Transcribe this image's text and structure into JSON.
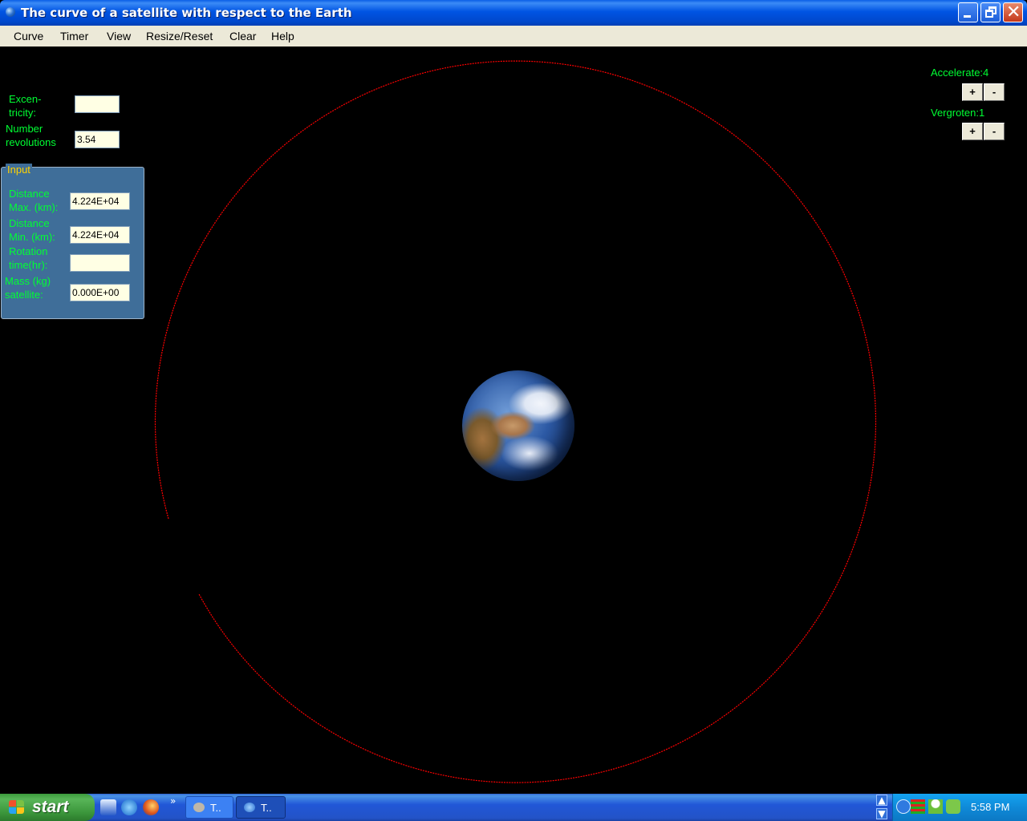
{
  "window": {
    "title": "The curve of a satellite with respect to the Earth",
    "min_icon": "minimize-icon",
    "max_icon": "restore-icon",
    "close_glyph": "✕"
  },
  "menu": [
    "Curve",
    "Timer",
    "View",
    "Resize/Reset",
    "Clear",
    "Help"
  ],
  "left_panel": {
    "eccentricity_label_1": "Excen-",
    "eccentricity_label_2": "tricity:",
    "eccentricity_value": "",
    "revolutions_label_1": "Number",
    "revolutions_label_2": "revolutions",
    "revolutions_value": "3.54"
  },
  "input_group": {
    "legend": "Input",
    "dist_max_label_1": "Distance",
    "dist_max_label_2": "Max. (km):",
    "dist_max_value": "4.224E+04",
    "dist_min_label_1": "Distance",
    "dist_min_label_2": "Min. (km):",
    "dist_min_value": "4.224E+04",
    "rotation_label_1": "Rotation",
    "rotation_label_2": "time(hr):",
    "rotation_value": "",
    "mass_label_1": "Mass (kg)",
    "mass_label_2": "satellite:",
    "mass_value": "0.000E+00"
  },
  "right_panel": {
    "accelerate_label": "Accelerate:4",
    "vergroten_label": "Vergroten:1",
    "plus": "+",
    "minus": "-"
  },
  "colors": {
    "label_green": "#00ff33",
    "orbit_red": "#ff0000",
    "legend_yellow": "#ffd200",
    "group_blue": "#3f6e99",
    "field_bg": "#ffffe4"
  },
  "taskbar": {
    "start_label": "start",
    "task1_label": "T..",
    "task2_label": "T..",
    "clock": "5:58 PM",
    "quicklaunch_more": "»"
  }
}
